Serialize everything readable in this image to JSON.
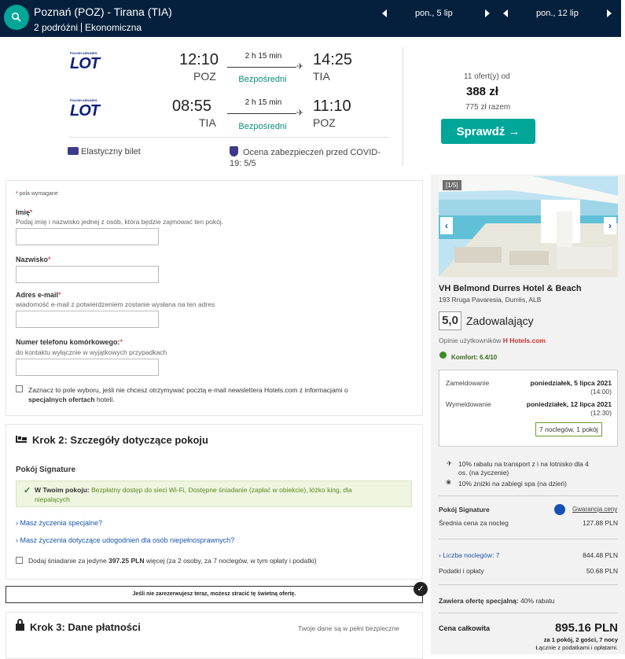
{
  "topbar": {
    "route": "Poznań (POZ) - Tirana (TIA)",
    "travellers": "2 podróżni",
    "cabin": "Ekonomiczna",
    "date_out": "pon., 5 lip",
    "date_back": "pon., 12 lip"
  },
  "flights": [
    {
      "airline": "LOT",
      "airline_tag": "POLISH AIRLINES",
      "dep_time": "12:10",
      "dep_code": "POZ",
      "duration": "2 h 15 min",
      "stops": "Bezpośredni",
      "arr_time": "14:25",
      "arr_code": "TIA"
    },
    {
      "airline": "LOT",
      "airline_tag": "POLISH AIRLINES",
      "dep_time": "08:55",
      "dep_code": "TIA",
      "duration": "2 h 15 min",
      "stops": "Bezpośredni",
      "arr_time": "11:10",
      "arr_code": "POZ"
    }
  ],
  "flight_features": {
    "flexible": "Elastyczny bilet",
    "covid": "Ocena zabezpieczeń przed COVID-19: 5/5"
  },
  "offer": {
    "count": "11 ofert(y) od",
    "price": "388 zł",
    "total": "775 zł razem",
    "button": "Sprawdź →"
  },
  "form": {
    "required_note": "pola wymagane",
    "first_name_label": "Imię",
    "first_name_hint": "Podaj imię i nazwisko jednej z osób, która będzie zajmować ten pokój.",
    "last_name_label": "Nazwisko",
    "email_label": "Adres e-mail",
    "email_hint": "wiadomość e-mail z potwierdzeniem zostanie wysłana na ten adres",
    "phone_label": "Numer telefonu komórkowego:",
    "phone_hint": "do kontaktu wyłącznie w wyjątkowych przypadkach",
    "newsletter_text": "Zaznacz to pole wyboru, jeśli nie chcesz otrzymywać pocztą e-mail newslettera Hotels.com z informacjami o",
    "newsletter_bold": "specjalnych ofertach",
    "newsletter_end": "hoteli."
  },
  "step2": {
    "title": "Krok 2: Szczegóły dotyczące pokoju",
    "room_name": "Pokój Signature",
    "in_room_label": "W Twoim pokoju:",
    "amenities": "Bezpłatny dostęp do sieci Wi-Fi, Dostępne śniadanie (zapłać w obiekcie), łóżko king, dla",
    "amenities_2": "niepalących",
    "special_requests": "Masz życzenia specjalne?",
    "accessibility": "Masz życzenia dotyczące udogodnień dla osób niepełnosprawnych?",
    "breakfast_pre": "Dodaj śniadanie za jedyne",
    "breakfast_price": "397.25 PLN",
    "breakfast_post": "więcej (za 2 osoby, za 7 noclegów, w tym opłaty i podatki)"
  },
  "banner": "Jeśli nie zarezerwujesz teraz, możesz stracić tę świetną ofertę.",
  "step3": {
    "title": "Krok 3: Dane płatności",
    "secure": "Twoje dane są w pełni bezpieczne"
  },
  "hotel": {
    "photo_counter": "[1/5]",
    "name": "VH Belmond Durres Hotel & Beach",
    "address": "193 Rruga Pavaresia, Durrës, ALB",
    "score": "5,0",
    "rating": "Zadowalający",
    "reviews_label": "Opinie użytkowników",
    "reviews_source": "Hotels.com",
    "comfort": "Komfort: 6.4/10",
    "checkin_label": "Zameldowanie",
    "checkin_date": "poniedziałek, 5 lipca 2021",
    "checkin_time": "(14:00)",
    "checkout_label": "Wymeldowanie",
    "checkout_date": "poniedziałek, 12 lipca 2021",
    "checkout_time": "(12:30)",
    "nights_box": "7 noclegów, 1 pokój",
    "perk_1": "10% rabatu na transport z i na lotnisko dla 4",
    "perk_1b": "os. (na życzenie)",
    "perk_2": "10% zniżki na zabiegi spa (na dzień)",
    "room": "Pokój Signature",
    "guarantee": "Gwarancja ceny",
    "avg_label": "Średnia cena za nocleg",
    "avg_value": "127.88 PLN",
    "nights_label": "Liczba noclegów: 7",
    "nights_value": "844.48 PLN",
    "taxes_label": "Podatki i opłaty",
    "taxes_value": "50.68 PLN",
    "special_label": "Zawiera ofertę specjalną:",
    "special_value": "40% rabatu",
    "total_label": "Cena całkowita",
    "total_value": "895.16 PLN",
    "total_sub": "za 1 pokój, 2 gości, 7 nocy",
    "total_sub2": "Łącznie z podatkami i opłatami."
  }
}
